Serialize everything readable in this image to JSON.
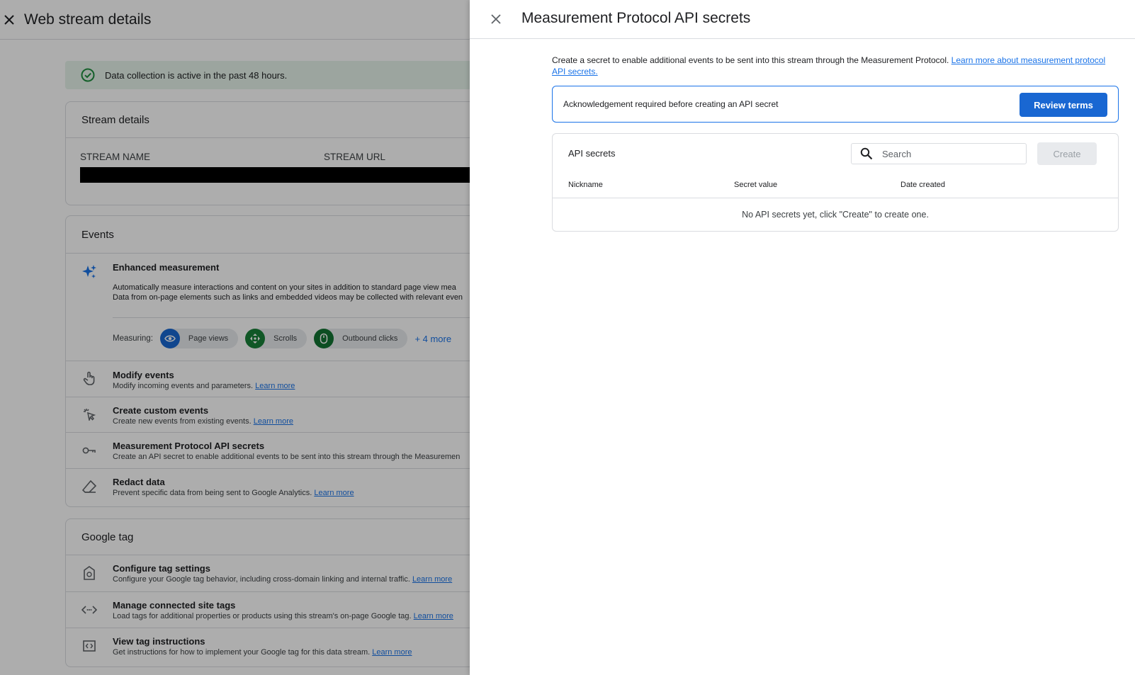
{
  "background": {
    "title": "Web stream details",
    "status_banner": "Data collection is active in the past 48 hours.",
    "stream_details": {
      "title": "Stream details",
      "columns": [
        "STREAM NAME",
        "STREAM URL"
      ]
    },
    "events": {
      "title": "Events",
      "enhanced": {
        "title": "Enhanced measurement",
        "desc1": "Automatically measure interactions and content on your sites in addition to standard page view mea",
        "desc2": "Data from on-page elements such as links and embedded videos may be collected with relevant even",
        "measuring_label": "Measuring:",
        "chips": [
          "Page views",
          "Scrolls",
          "Outbound clicks"
        ],
        "more": "+ 4 more"
      },
      "rows": [
        {
          "title": "Modify events",
          "desc": "Modify incoming events and parameters.",
          "link": "Learn more"
        },
        {
          "title": "Create custom events",
          "desc": "Create new events from existing events.",
          "link": "Learn more"
        },
        {
          "title": "Measurement Protocol API secrets",
          "desc": "Create an API secret to enable additional events to be sent into this stream through the Measuremen",
          "link": ""
        },
        {
          "title": "Redact data",
          "desc": "Prevent specific data from being sent to Google Analytics.",
          "link": "Learn more"
        }
      ]
    },
    "google_tag": {
      "title": "Google tag",
      "rows": [
        {
          "title": "Configure tag settings",
          "desc": "Configure your Google tag behavior, including cross-domain linking and internal traffic.",
          "link": "Learn more"
        },
        {
          "title": "Manage connected site tags",
          "desc": "Load tags for additional properties or products using this stream's on-page Google tag.",
          "link": "Learn more"
        },
        {
          "title": "View tag instructions",
          "desc": "Get instructions for how to implement your Google tag for this data stream.",
          "link": "Learn more"
        }
      ]
    }
  },
  "panel": {
    "title": "Measurement Protocol API secrets",
    "intro": "Create a secret to enable additional events to be sent into this stream through the Measurement Protocol.",
    "intro_link": "Learn more about measurement protocol API secrets.",
    "ack_text": "Acknowledgement required before creating an API secret",
    "review_button": "Review terms",
    "secrets_title": "API secrets",
    "search_placeholder": "Search",
    "create_button": "Create",
    "columns": [
      "Nickname",
      "Secret value",
      "Date created"
    ],
    "empty_text": "No API secrets yet, click \"Create\" to create one."
  },
  "colors": {
    "accent": "#1a73e8",
    "primary_button": "#1967d2",
    "success": "#1e8e3e",
    "banner_bg": "#e6f4ea"
  }
}
